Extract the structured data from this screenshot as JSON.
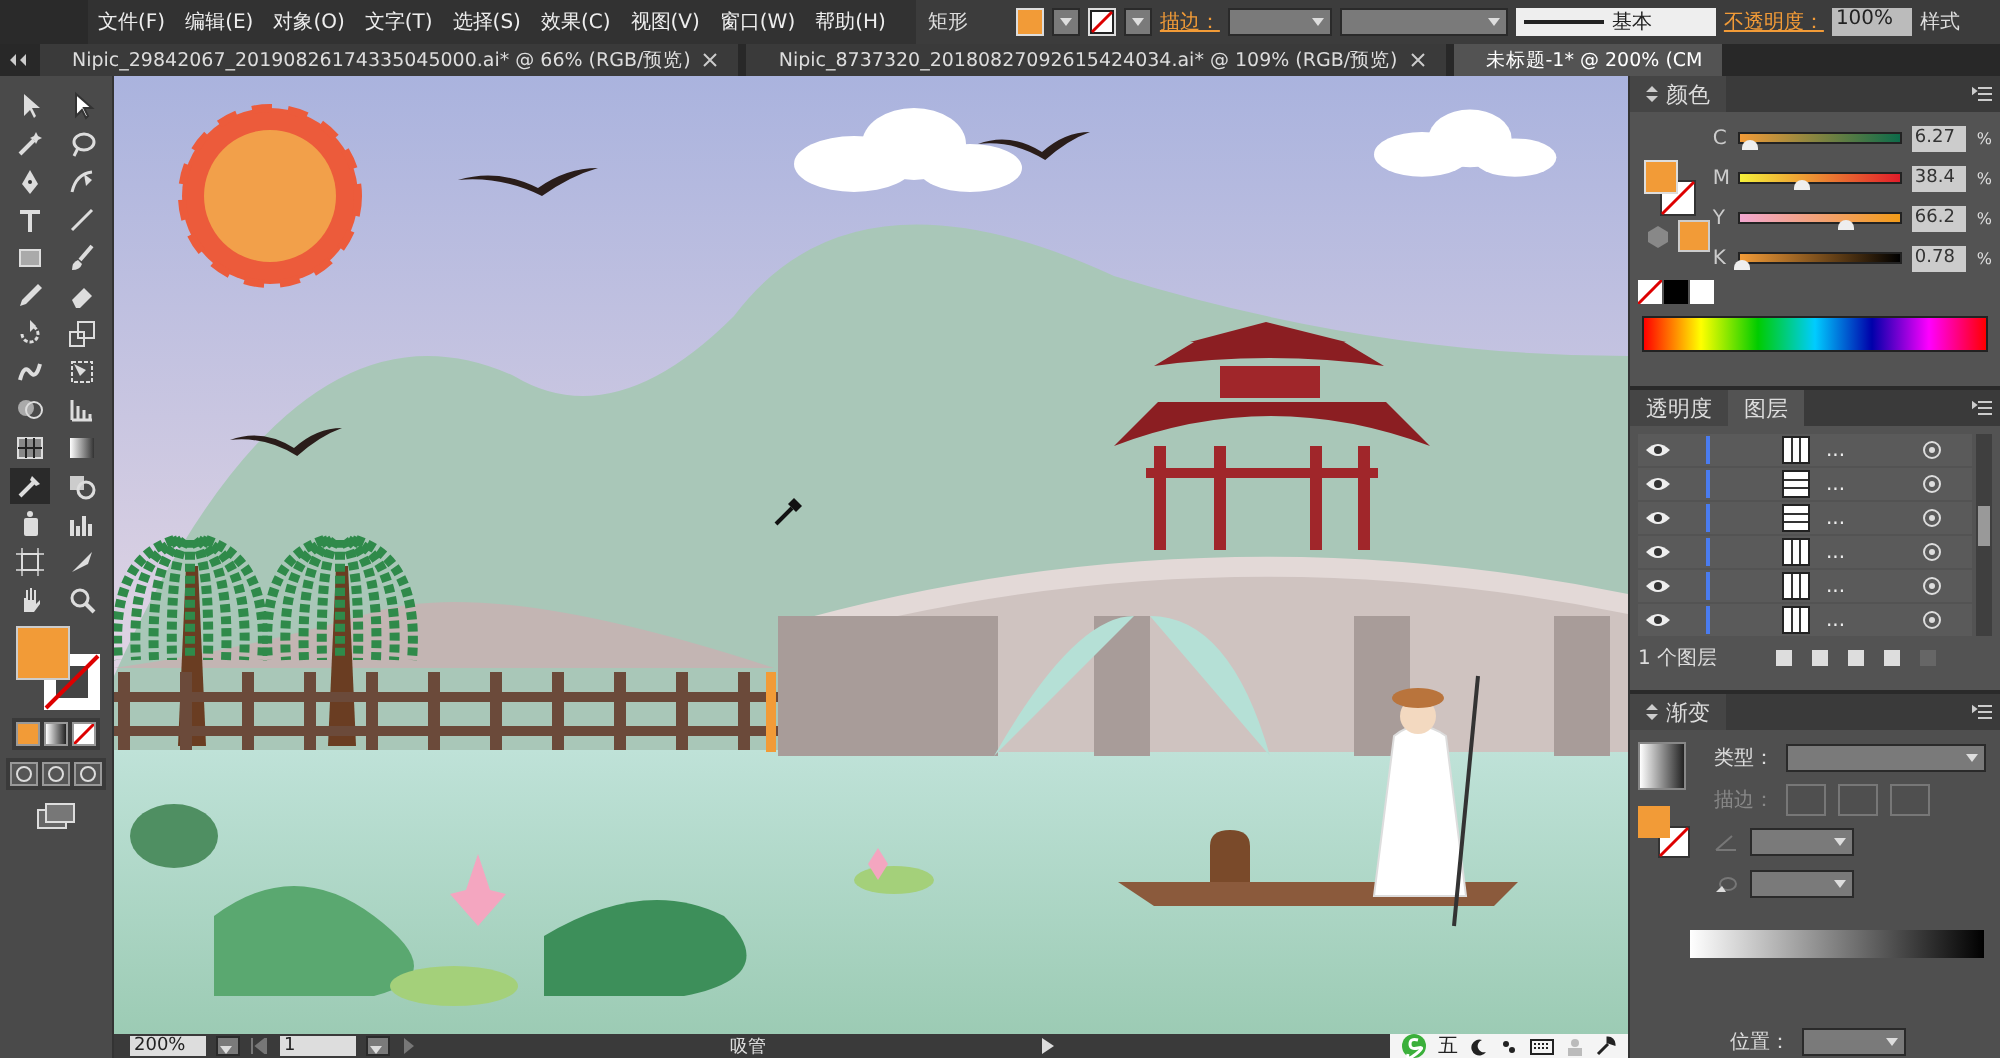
{
  "menu": [
    "文件(F)",
    "编辑(E)",
    "对象(O)",
    "文字(T)",
    "选择(S)",
    "效果(C)",
    "视图(V)",
    "窗口(W)",
    "帮助(H)"
  ],
  "control_bar": {
    "object": "矩形",
    "stroke_label": "描边：",
    "stroke_style": "基本",
    "opacity_label": "不透明度：",
    "opacity": "100%",
    "style_label": "样式"
  },
  "tabs": [
    {
      "label": "Nipic_29842067_20190826174335045000.ai* @ 66% (RGB/预览)",
      "selected": false
    },
    {
      "label": "Nipic_8737320_20180827092615424034.ai* @ 109% (RGB/预览)",
      "selected": false
    },
    {
      "label": "未标题-1* @ 200% (CM",
      "selected": true
    }
  ],
  "tools": [
    {
      "kind": "select",
      "selected": false
    },
    {
      "kind": "direct",
      "selected": false
    },
    {
      "kind": "wand",
      "selected": false
    },
    {
      "kind": "lasso",
      "selected": false
    },
    {
      "kind": "pen",
      "selected": false
    },
    {
      "kind": "curvature",
      "selected": false
    },
    {
      "kind": "type",
      "selected": false
    },
    {
      "kind": "line",
      "selected": false
    },
    {
      "kind": "rect",
      "selected": false
    },
    {
      "kind": "brush",
      "selected": false
    },
    {
      "kind": "pencil",
      "selected": false
    },
    {
      "kind": "eraser",
      "selected": false
    },
    {
      "kind": "rotate",
      "selected": false
    },
    {
      "kind": "scale",
      "selected": false
    },
    {
      "kind": "warp",
      "selected": false
    },
    {
      "kind": "transform",
      "selected": false
    },
    {
      "kind": "builder",
      "selected": false
    },
    {
      "kind": "graph",
      "selected": false
    },
    {
      "kind": "mesh",
      "selected": false
    },
    {
      "kind": "gradient",
      "selected": false
    },
    {
      "kind": "eyedropper",
      "selected": true
    },
    {
      "kind": "blend",
      "selected": false
    },
    {
      "kind": "symbol",
      "selected": false
    },
    {
      "kind": "column",
      "selected": false
    },
    {
      "kind": "artboard",
      "selected": false
    },
    {
      "kind": "slice",
      "selected": false
    },
    {
      "kind": "hand",
      "selected": false
    },
    {
      "kind": "zoom",
      "selected": false
    }
  ],
  "color_panel": {
    "title": "颜色",
    "channels": [
      {
        "name": "C",
        "level": 0.06,
        "reading": "6.27",
        "unit": "%"
      },
      {
        "name": "M",
        "level": 0.38,
        "reading": "38.4",
        "unit": "%"
      },
      {
        "name": "Y",
        "level": 0.66,
        "reading": "66.2",
        "unit": "%"
      },
      {
        "name": "K",
        "level": 0.01,
        "reading": "0.78",
        "unit": "%"
      }
    ]
  },
  "layers_panel": {
    "tabs": [
      {
        "label": "透明度",
        "selected": false
      },
      {
        "label": "图层",
        "selected": true
      }
    ],
    "rows": [
      {
        "name": "...",
        "kind": "vertical"
      },
      {
        "name": "...",
        "kind": "horizontal"
      },
      {
        "name": "...",
        "kind": "horizontal"
      },
      {
        "name": "...",
        "kind": "vertical"
      },
      {
        "name": "...",
        "kind": "vertical"
      },
      {
        "name": "...",
        "kind": "vertical"
      }
    ],
    "footer": "1 个图层"
  },
  "gradient_panel": {
    "title": "渐变",
    "type_label": "类型：",
    "stroke_label": "描边：",
    "position_label": "位置："
  },
  "status_bar": {
    "zoom": "200%",
    "artboard": "1",
    "tool": "吸管"
  },
  "ime_bar": {
    "mode": "五"
  }
}
